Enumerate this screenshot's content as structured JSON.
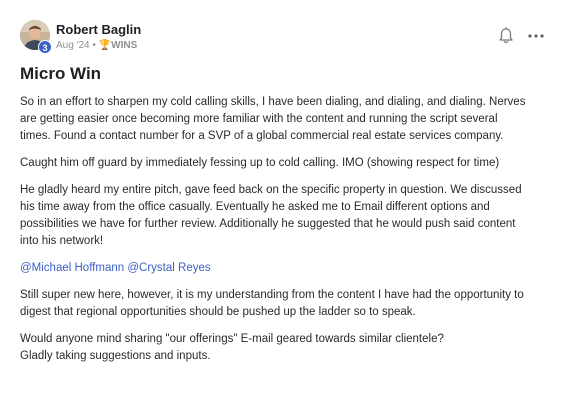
{
  "post": {
    "author": "Robert Baglin",
    "level": "3",
    "date": "Aug '24",
    "separator": "•",
    "category_icon": "🏆",
    "category": "WINS",
    "title": "Micro Win",
    "paragraphs": {
      "p1": [
        "So in an effort to sharpen my cold calling skills, I have been dialing, and dialing, and dialing. Nerves",
        "are getting easier once becoming more familiar with the content and running the script several",
        "times. Found a contact number for a SVP of a global commercial real estate services company."
      ],
      "p2": [
        "Caught him off guard by immediately fessing up to cold calling. IMO (showing respect for time)"
      ],
      "p3": [
        "He gladly heard my entire pitch, gave feed back on the specific property in question. We discussed",
        "his time away from the office casually. Eventually he asked me to Email different options and",
        "possibilities we have for further review. Additionally he suggested that he would push said content",
        "into his network!"
      ],
      "mentions": [
        "@Michael Hoffmann",
        "@Crystal Reyes"
      ],
      "p5": [
        "Still super new here, however, it is my understanding from the content I have had the opportunity to",
        "digest that regional opportunities should be pushed up the ladder so to speak."
      ],
      "p6": [
        "Would anyone mind sharing \"our offerings\" E-mail geared towards similar clientele?",
        "Gladly taking suggestions and inputs."
      ]
    }
  },
  "icons": {
    "notify": "bell-icon",
    "more": "more-horizontal-icon"
  },
  "colors": {
    "mention": "#3b62c4",
    "level_badge": "#3b62c4",
    "meta": "#909090"
  }
}
